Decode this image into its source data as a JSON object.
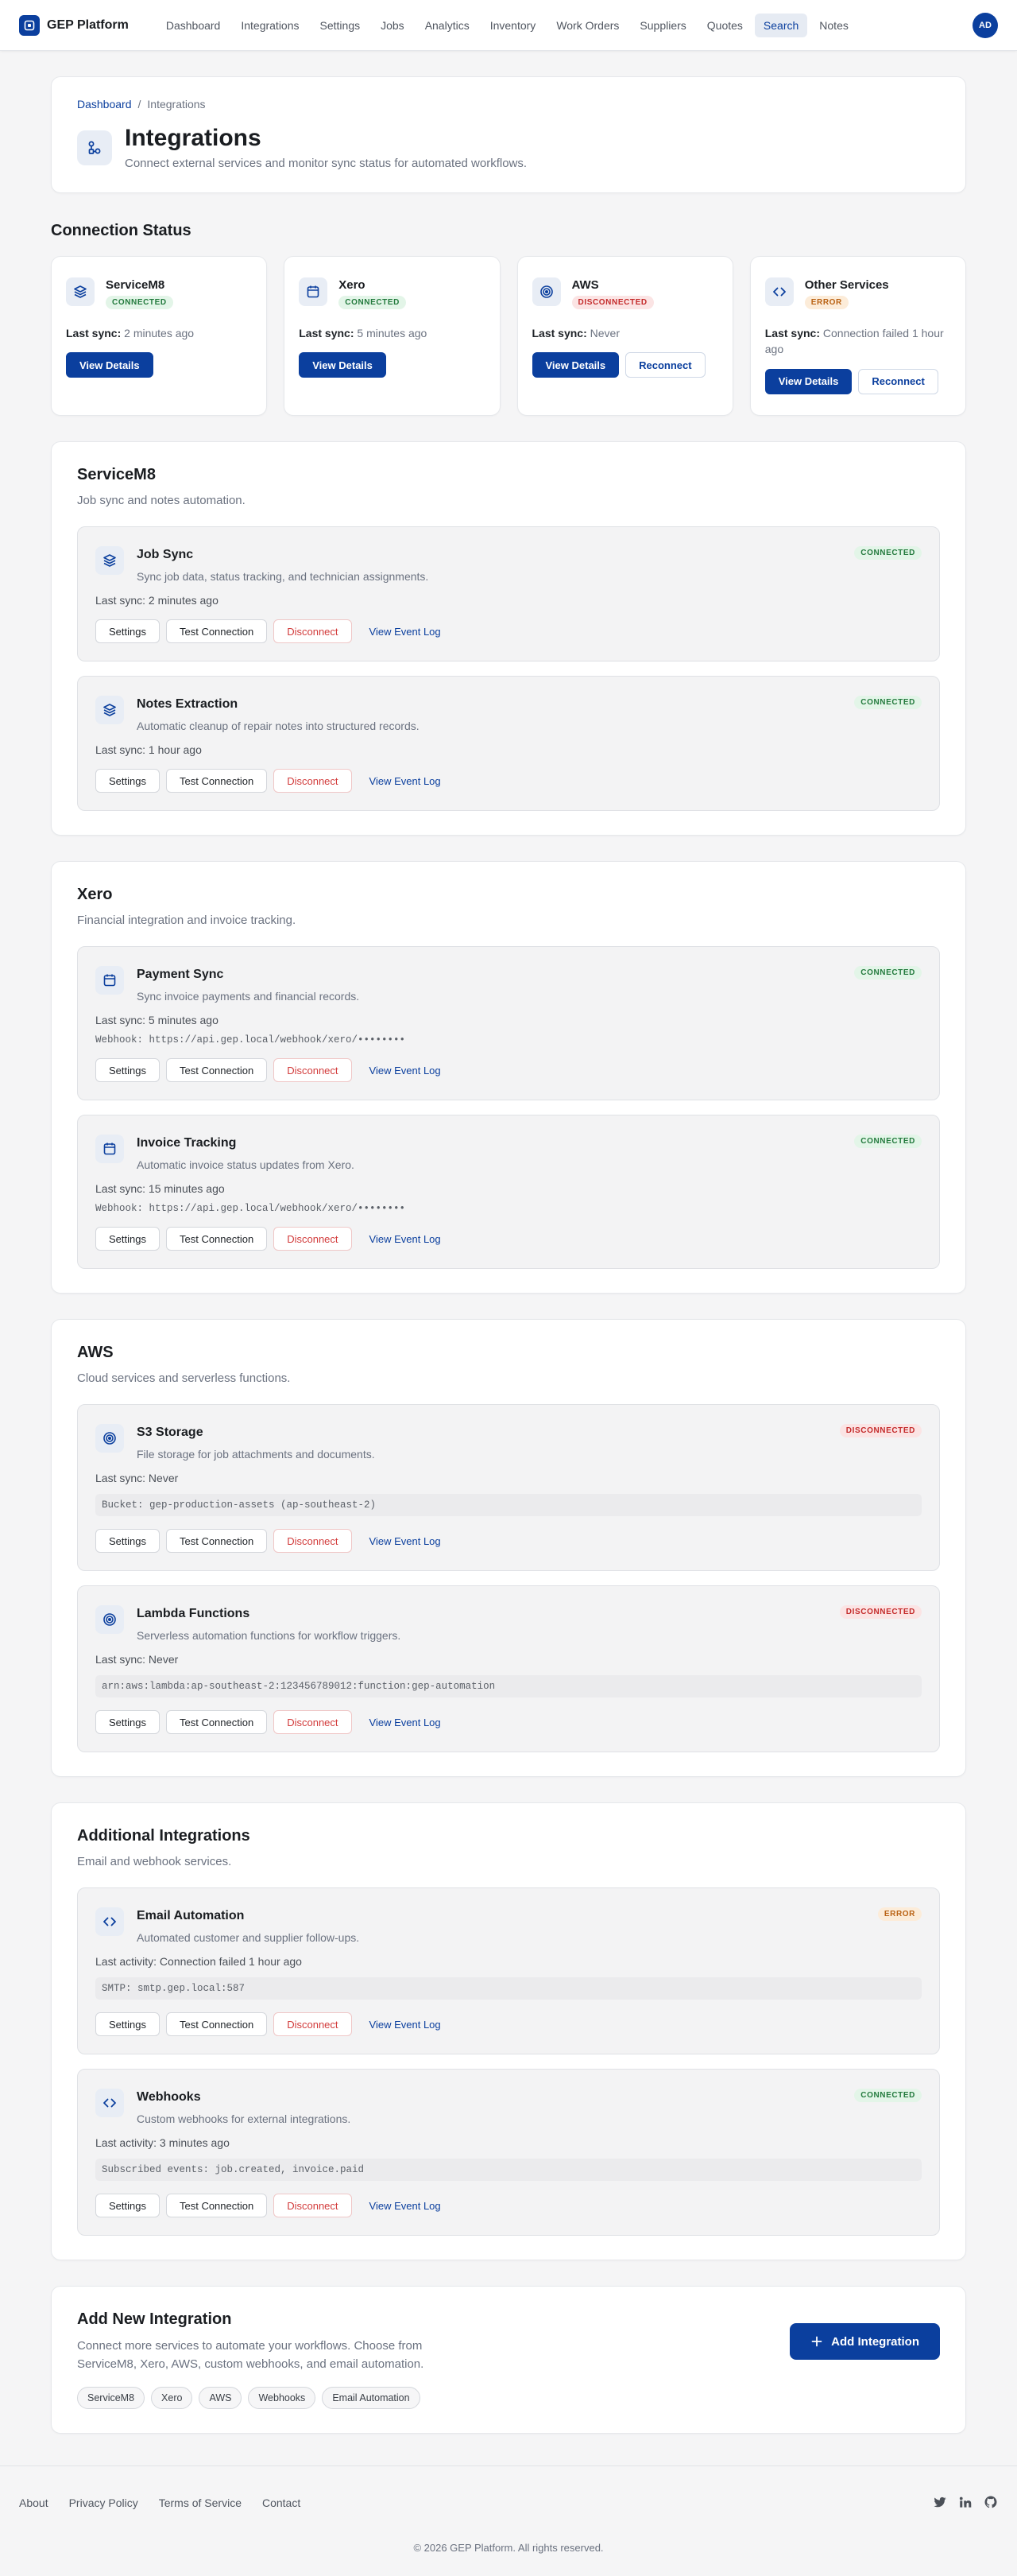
{
  "brand": {
    "name": "GEP Platform"
  },
  "nav": {
    "items": [
      "Dashboard",
      "Integrations",
      "Settings",
      "Jobs",
      "Analytics",
      "Inventory",
      "Work Orders",
      "Suppliers",
      "Quotes",
      "Search",
      "Notes"
    ],
    "active": "Search",
    "avatar_initials": "AD"
  },
  "breadcrumb": {
    "root": "Dashboard",
    "separator": "/",
    "current": "Integrations"
  },
  "page": {
    "title": "Integrations",
    "subtitle": "Connect external services and monitor sync status for automated workflows."
  },
  "connection_status": {
    "title": "Connection Status",
    "cards": [
      {
        "name": "ServiceM8",
        "icon": "layers-icon",
        "status": "CONNECTED",
        "status_key": "connected",
        "sync_label": "Last sync:",
        "sync_value": "2 minutes ago",
        "primary": "View Details",
        "secondary": ""
      },
      {
        "name": "Xero",
        "icon": "calendar-icon",
        "status": "CONNECTED",
        "status_key": "connected",
        "sync_label": "Last sync:",
        "sync_value": "5 minutes ago",
        "primary": "View Details",
        "secondary": ""
      },
      {
        "name": "AWS",
        "icon": "target-icon",
        "status": "DISCONNECTED",
        "status_key": "disconnected",
        "sync_label": "Last sync:",
        "sync_value": "Never",
        "primary": "View Details",
        "secondary": "Reconnect"
      },
      {
        "name": "Other Services",
        "icon": "code-icon",
        "status": "ERROR",
        "status_key": "error",
        "sync_label": "Last sync:",
        "sync_value": "Connection failed 1 hour ago",
        "primary": "View Details",
        "secondary": "Reconnect"
      }
    ]
  },
  "actions": {
    "settings": "Settings",
    "test": "Test Connection",
    "disconnect": "Disconnect",
    "log": "View Event Log"
  },
  "groups": [
    {
      "title": "ServiceM8",
      "subtitle": "Job sync and notes automation.",
      "items": [
        {
          "name": "Job Sync",
          "icon": "layers-icon",
          "desc": "Sync job data, status tracking, and technician assignments.",
          "status": "CONNECTED",
          "status_key": "connected",
          "sync": "Last sync: 2 minutes ago",
          "extra": "",
          "extra_style": ""
        },
        {
          "name": "Notes Extraction",
          "icon": "layers-icon",
          "desc": "Automatic cleanup of repair notes into structured records.",
          "status": "CONNECTED",
          "status_key": "connected",
          "sync": "Last sync: 1 hour ago",
          "extra": "",
          "extra_style": ""
        }
      ]
    },
    {
      "title": "Xero",
      "subtitle": "Financial integration and invoice tracking.",
      "items": [
        {
          "name": "Payment Sync",
          "icon": "calendar-icon",
          "desc": "Sync invoice payments and financial records.",
          "status": "CONNECTED",
          "status_key": "connected",
          "sync": "Last sync: 5 minutes ago",
          "extra": "Webhook: https://api.gep.local/webhook/xero/••••••••",
          "extra_style": "line"
        },
        {
          "name": "Invoice Tracking",
          "icon": "calendar-icon",
          "desc": "Automatic invoice status updates from Xero.",
          "status": "CONNECTED",
          "status_key": "connected",
          "sync": "Last sync: 15 minutes ago",
          "extra": "Webhook: https://api.gep.local/webhook/xero/••••••••",
          "extra_style": "line"
        }
      ]
    },
    {
      "title": "AWS",
      "subtitle": "Cloud services and serverless functions.",
      "items": [
        {
          "name": "S3 Storage",
          "icon": "target-icon",
          "desc": "File storage for job attachments and documents.",
          "status": "DISCONNECTED",
          "status_key": "disconnected",
          "sync": "Last sync: Never",
          "extra": "Bucket: gep-production-assets (ap-southeast-2)",
          "extra_style": "box"
        },
        {
          "name": "Lambda Functions",
          "icon": "target-icon",
          "desc": "Serverless automation functions for workflow triggers.",
          "status": "DISCONNECTED",
          "status_key": "disconnected",
          "sync": "Last sync: Never",
          "extra": "arn:aws:lambda:ap-southeast-2:123456789012:function:gep-automation",
          "extra_style": "box"
        }
      ]
    },
    {
      "title": "Additional Integrations",
      "subtitle": "Email and webhook services.",
      "items": [
        {
          "name": "Email Automation",
          "icon": "code-icon",
          "desc": "Automated customer and supplier follow-ups.",
          "status": "ERROR",
          "status_key": "error",
          "sync": "Last activity: Connection failed 1 hour ago",
          "extra": "SMTP: smtp.gep.local:587",
          "extra_style": "box"
        },
        {
          "name": "Webhooks",
          "icon": "code-icon",
          "desc": "Custom webhooks for external integrations.",
          "status": "CONNECTED",
          "status_key": "connected",
          "sync": "Last activity: 3 minutes ago",
          "extra": "Subscribed events: job.created, invoice.paid",
          "extra_style": "box"
        }
      ]
    }
  ],
  "add_new": {
    "title": "Add New Integration",
    "desc": "Connect more services to automate your workflows. Choose from ServiceM8, Xero, AWS, custom webhooks, and email automation.",
    "chips": [
      "ServiceM8",
      "Xero",
      "AWS",
      "Webhooks",
      "Email Automation"
    ],
    "button": "Add Integration"
  },
  "footer": {
    "links": [
      "About",
      "Privacy Policy",
      "Terms of Service",
      "Contact"
    ],
    "socials": [
      "twitter-icon",
      "linkedin-icon",
      "github-icon"
    ],
    "copyright": "© 2026 GEP Platform. All rights reserved."
  },
  "colors": {
    "primary": "#0b3f9e",
    "connected": "#237a3d",
    "disconnected": "#c42b2b",
    "error": "#b96214"
  }
}
